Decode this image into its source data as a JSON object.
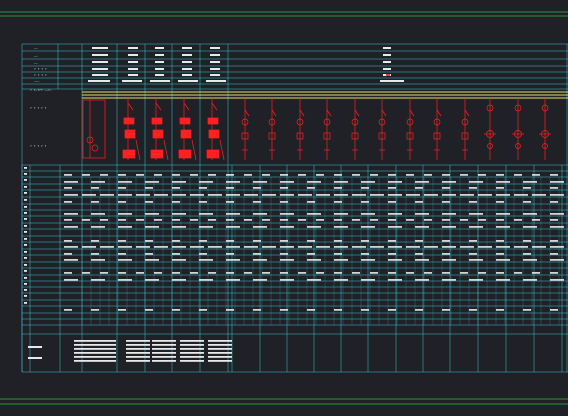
{
  "drawing": {
    "background": "#1f2127",
    "frame_color": "#2fbf3f",
    "grid_color": "#39c6d6",
    "component_color": "#ff2020",
    "bus_color": "#e8e060",
    "text_color": "#e8e8e8"
  },
  "header_rows": {
    "left_labels": [
      "——",
      "——",
      "——",
      "? ? ? ?",
      "? ? ? ?",
      "———",
      "? ?—??? ——?—"
    ],
    "col_marks": [
      "?",
      "?",
      "?",
      "?",
      "?",
      "?"
    ]
  },
  "schedule": {
    "row_numbers": [
      "1",
      "2",
      "3",
      "4",
      "5",
      "6",
      "7",
      "8",
      "9",
      "10",
      "11",
      "12",
      "13",
      "14",
      "15",
      "16",
      "17",
      "18",
      "19",
      "20",
      "21"
    ],
    "left_labels_top": [
      "? ? ? ? ?",
      "? ? ? ? ?"
    ],
    "section_marks": [
      "L?",
      "L?",
      "L?",
      "L?",
      "L?",
      "L?",
      "L?",
      "L?",
      "L?",
      "?"
    ],
    "bottom_marks": [
      "?",
      "?",
      "?"
    ]
  }
}
